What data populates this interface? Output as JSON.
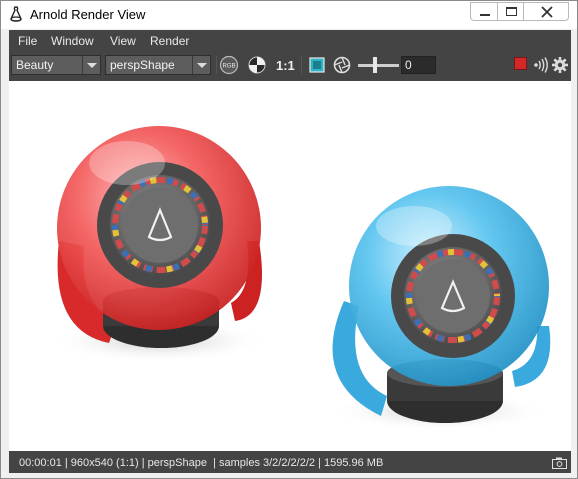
{
  "window": {
    "title": "Arnold Render View"
  },
  "menubar": {
    "items": [
      "File",
      "Window",
      "View",
      "Render"
    ]
  },
  "toolbar": {
    "aov": "Beauty",
    "camera": "perspShape",
    "rgb_icon": "rgb-channel-icon",
    "ratio": "1:1",
    "frame": "0",
    "icons": [
      "rgb-channel-icon",
      "color-circle-icon",
      "crop-region-icon",
      "shutter-icon",
      "stop-render-icon",
      "ipr-icon",
      "settings-gear-icon"
    ],
    "stop_color": "#d42828"
  },
  "statusbar": {
    "text": "00:00:01 | 960x540 (1:1) | perspShape  | samples 3/2/2/2/2/2 | 1595.96 MB"
  },
  "viewport": {
    "content": "rendered-spheres-image",
    "left_sphere_color": "#ef3b3b",
    "right_sphere_color": "#3fb6e6"
  }
}
